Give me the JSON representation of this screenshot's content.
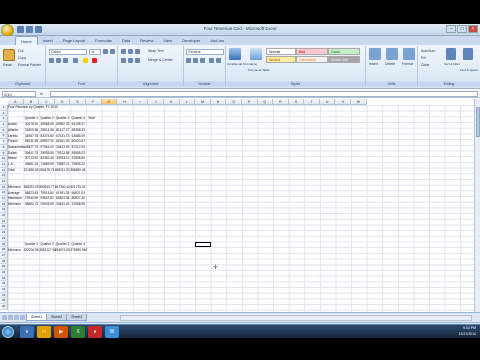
{
  "window": {
    "title": "Four Revenue Grid - Microsoft Excel"
  },
  "tabs": [
    "Home",
    "Insert",
    "Page Layout",
    "Formulas",
    "Data",
    "Review",
    "View",
    "Developer",
    "Add-Ins"
  ],
  "ribbon": {
    "clipboard": {
      "paste": "Paste",
      "cut": "Cut",
      "copy": "Copy",
      "format_painter": "Format Painter",
      "label": "Clipboard"
    },
    "font": {
      "name": "Calibri",
      "size": "11",
      "label": "Font"
    },
    "alignment": {
      "wrap": "Wrap Text",
      "merge": "Merge & Center",
      "label": "Alignment"
    },
    "number": {
      "format": "General",
      "label": "Number"
    },
    "styles": {
      "conditional": "Conditional Formatting",
      "format_table": "Format as Table",
      "normal": "Normal",
      "bad": "Bad",
      "good": "Good",
      "neutral": "Neutral",
      "calculation": "Calculation",
      "check_cell": "Check Cell",
      "label": "Styles"
    },
    "cells": {
      "insert": "Insert",
      "delete": "Delete",
      "format": "Format",
      "label": "Cells"
    },
    "editing": {
      "autosum": "AutoSum",
      "fill": "Fill",
      "clear": "Clear",
      "sort": "Sort & Filter",
      "find": "Find & Select",
      "label": "Editing"
    }
  },
  "formula_bar": {
    "name_box": "G19",
    "fx": "fx",
    "formula": ""
  },
  "columns": [
    "A",
    "B",
    "C",
    "D",
    "E",
    "F",
    "G",
    "H",
    "I",
    "J",
    "K",
    "L",
    "M",
    "N",
    "O",
    "P",
    "Q",
    "R",
    "S",
    "T",
    "U",
    "V",
    "W"
  ],
  "rows": [
    "1",
    "2",
    "3",
    "4",
    "5",
    "6",
    "7",
    "8",
    "9",
    "10",
    "11",
    "12",
    "13",
    "14",
    "15",
    "16",
    "17",
    "18",
    "19",
    "20",
    "21",
    "22",
    "23",
    "24",
    "25",
    "26",
    "27",
    "28",
    "29",
    "30",
    "31",
    "32",
    "33",
    "34",
    "35",
    "36"
  ],
  "sheet": {
    "title": "Four Revenue by Quarter, FY 2010",
    "headers": [
      "Quarter 1",
      "Quarter 2",
      "Quarter 3",
      "Quarter 4",
      "Total"
    ],
    "cities": [
      {
        "name": "Austin",
        "values": [
          "30478.92",
          "39888.55",
          "80952.33",
          "63155.47"
        ]
      },
      {
        "name": "Atlanta",
        "values": [
          "31809.96",
          "29514.66",
          "81417.27",
          "58388.33"
        ]
      },
      {
        "name": "Laredo",
        "values": [
          "34987.78",
          "83375.80",
          "67431.73",
          "63686.09"
        ]
      },
      {
        "name": "Fresno",
        "values": [
          "86311.95",
          "69897.92",
          "82341.33",
          "60520.67"
        ]
      },
      {
        "name": "Sacramento",
        "values": [
          "49827.79",
          "97946.02",
          "30403.09",
          "57212.93"
        ]
      },
      {
        "name": "Dallas",
        "values": [
          "39641.78",
          "29535.55",
          "79313.98",
          "59585.03"
        ]
      },
      {
        "name": "Miami",
        "values": [
          "30713.92",
          "82382.46",
          "39913.11",
          "37558.99"
        ]
      },
      {
        "name": "L.A.",
        "values": [
          "49881.24",
          "71889.99",
          "75887.11",
          "75895.22"
        ]
      },
      {
        "name": "Total",
        "values": [
          "221590.60",
          "250478.74",
          "485211.93",
          "386899.46"
        ]
      }
    ],
    "stats": [
      {
        "name": "Minimum",
        "values": [
          "368331.09",
          "550943.77",
          "567300.43",
          "421275.31"
        ]
      },
      {
        "name": "Average",
        "values": [
          "68823.63",
          "79915.64",
          "61591.35",
          "66621.04"
        ]
      },
      {
        "name": "Maximum",
        "values": [
          "79940.69",
          "93647.82",
          "80823.08",
          "80827.40"
        ]
      },
      {
        "name": "Minimum",
        "values": [
          "38862.73",
          "29535.55",
          "30403.09",
          "37558.99"
        ]
      }
    ],
    "headers2": [
      "Quarter 1",
      "Quarter 2",
      "Quarter 3",
      "Quarter 4"
    ],
    "summary": {
      "name": "Minimum",
      "values": [
        "322200.96",
        "3952127.96",
        "254872.95",
        "378959.960"
      ]
    }
  },
  "sheet_tabs": [
    "Sheet1",
    "Sheet2",
    "Sheet3"
  ],
  "status": {
    "ready": "Ready",
    "zoom": "100%"
  },
  "taskbar": {
    "time": "9:33 PM",
    "date": "12/21/2010"
  }
}
